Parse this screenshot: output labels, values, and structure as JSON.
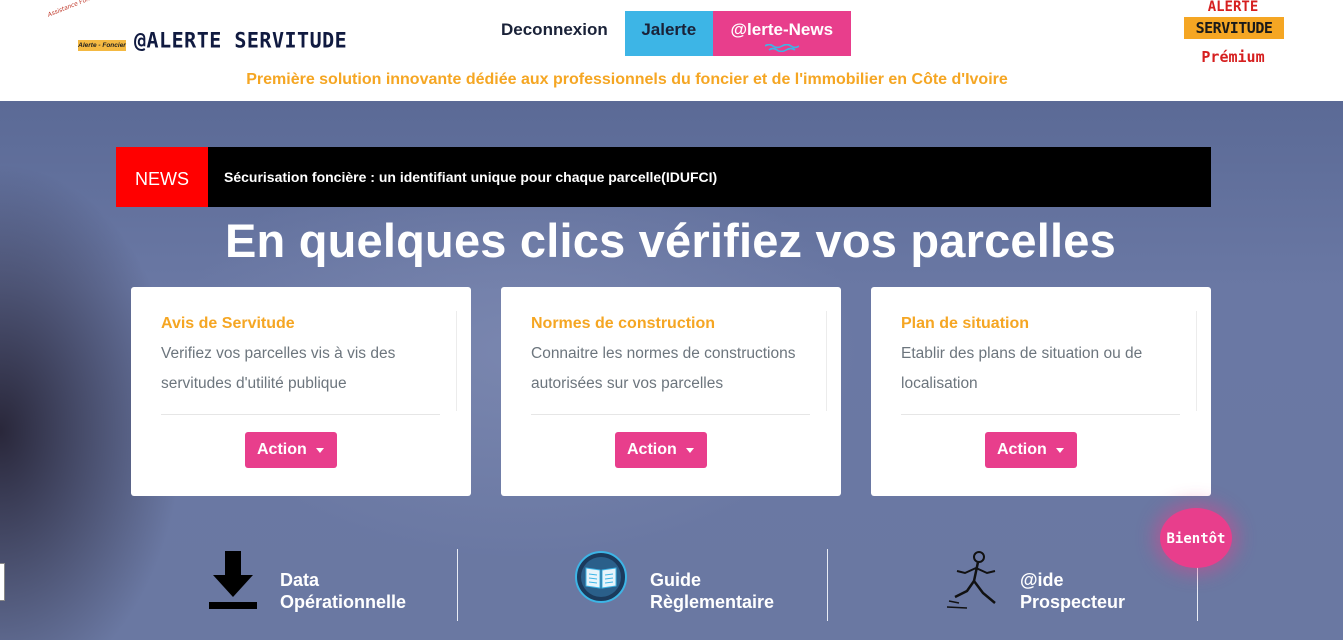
{
  "header": {
    "logo": {
      "badge_arc_text": "Assistance Foncière & Immobilière",
      "badge_tag": "Alerte - Foncier",
      "brand_name": "@ALERTE SERVITUDE"
    },
    "nav": {
      "deconnexion": "Deconnexion",
      "jalerte": "Jalerte",
      "news": "@lerte-News"
    },
    "tagline": "Première solution innovante dédiée aux professionnels du foncier et de l'immobilier en Côte d'Ivoire",
    "premium": {
      "line1": "ALERTE",
      "line2": "SERVITUDE",
      "label": "Prémium"
    }
  },
  "news": {
    "label": "NEWS",
    "headline": "Sécurisation foncière : un identifiant unique pour chaque parcelle(IDUFCI)"
  },
  "hero": {
    "title": "En quelques clics vérifiez vos parcelles"
  },
  "cards": [
    {
      "title": "Avis de Servitude",
      "description": "Verifiez vos parcelles vis à vis des servitudes d'utilité publique",
      "button": "Action"
    },
    {
      "title": "Normes de construction",
      "description": "Connaitre les normes de constructions autorisées sur vos parcelles",
      "button": "Action"
    },
    {
      "title": "Plan de situation",
      "description": "Etablir des plans de situation ou de localisation",
      "button": "Action"
    }
  ],
  "features": [
    {
      "line1": "Data",
      "line2": "Opérationnelle",
      "icon": "download-icon"
    },
    {
      "line1": "Guide",
      "line2": "Règlementaire",
      "icon": "book-icon"
    },
    {
      "line1": "@ide",
      "line2": "Prospecteur",
      "icon": "runner-icon"
    }
  ],
  "badge": {
    "bientot": "Bientôt"
  },
  "colors": {
    "accent_pink": "#e83e8c",
    "accent_orange": "#f5a623",
    "nav_blue": "#3db5e6",
    "news_red": "#ff0000"
  }
}
